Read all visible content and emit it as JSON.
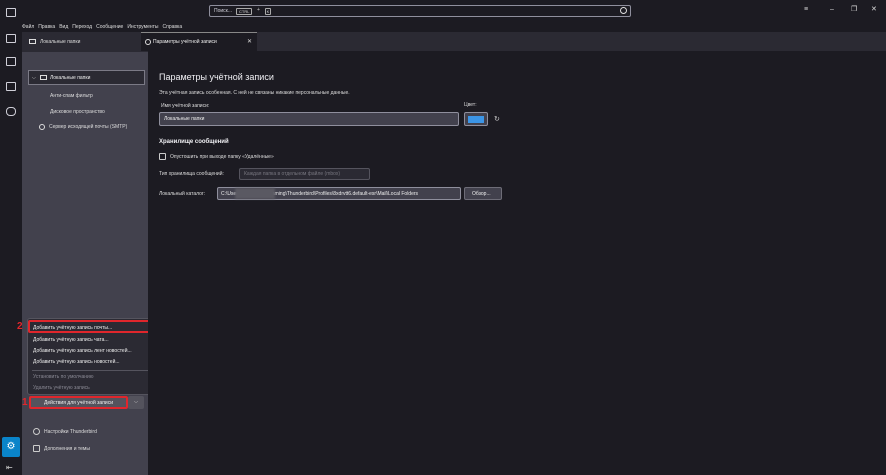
{
  "search": {
    "placeholder": "Поиск...",
    "shortcut_key1": "CTRL",
    "shortcut_plus": "+",
    "shortcut_key2": "K"
  },
  "window_controls": {
    "menu": "≡",
    "minimize": "–",
    "restore": "❐",
    "close": "✕"
  },
  "menubar": {
    "items": [
      "Файл",
      "Правка",
      "Вид",
      "Переход",
      "Сообщение",
      "Инструменты",
      "Справка"
    ]
  },
  "folder_pane": {
    "tab_label": "Локальные папки",
    "tree": {
      "root_label": "Локальные папки",
      "children": [
        "Анти-спам фильтр",
        "Дисковое пространство",
        "Сервер исходящей почты (SMTP)"
      ]
    }
  },
  "popup_menu": {
    "items": [
      {
        "label": "Добавить учётную запись почты...",
        "enabled": true
      },
      {
        "label": "Добавить учётную запись чата...",
        "enabled": true
      },
      {
        "label": "Добавить учётную запись лент новостей...",
        "enabled": true
      },
      {
        "label": "Добавить учётную запись новостей...",
        "enabled": true
      },
      {
        "label": "Установить по умолчанию",
        "enabled": false
      },
      {
        "label": "Удалить учётную запись",
        "enabled": false
      }
    ]
  },
  "annotations": {
    "badge_1": "1",
    "badge_2": "2",
    "highlight_color": "#e0262c"
  },
  "account_actions_button": {
    "label": "Действия для учётной записи",
    "dropdown": "⌵"
  },
  "bottom_items": {
    "settings": "Настройки Thunderbird",
    "addons": "Дополнения и темы"
  },
  "content_tab": {
    "label": "Параметры учётной записи",
    "close": "✕"
  },
  "account_settings": {
    "title": "Параметры учётной записи",
    "description": "Эта учётная запись особенная. С ней не связаны никакие персональные данные.",
    "account_name_label": "Имя учётной записи:",
    "account_name_value": "Локальные папки",
    "color_label": "Цвет:",
    "color_value": "#3c95e6",
    "reset_icon": "↻",
    "storage_heading": "Хранилище сообщений",
    "empty_trash_label": "Опустошить при выходе папку «Удалённые»",
    "storage_type_label": "Тип хранилища сообщений:",
    "storage_type_value": "Каждая папка в отдельном файле (mbox)",
    "local_dir_label": "Локальный каталог:",
    "local_dir_value": "C:\\Users\\            \\AppData\\Roaming\\Thunderbird\\Profiles\\8xdrvtt6.default-esr\\Mail\\Local Folders",
    "browse_label": "Обзор..."
  },
  "colors": {
    "accent": "#0a84c9",
    "background": "#1c1b22",
    "pane": "#42414d"
  }
}
